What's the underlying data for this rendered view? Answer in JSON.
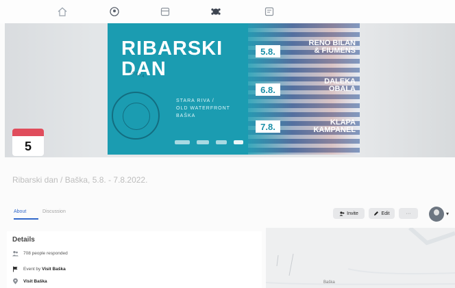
{
  "nav": {
    "icons": [
      "home-icon",
      "friends-icon",
      "store-icon",
      "groups-icon",
      "gaming-icon"
    ]
  },
  "banner": {
    "kicker": "",
    "title_line1": "RIBARSKI",
    "title_line2": "DAN",
    "venue_line1": "STARA RIVA /",
    "venue_line2": "OLD WATERFRONT",
    "venue_line3": "BAŠKA",
    "stamp_text": "BAŠKA",
    "lineup": [
      {
        "date": "5.8.",
        "performer_line1": "RENO BILAN",
        "performer_line2": "& FIUMENS"
      },
      {
        "date": "6.8.",
        "performer_line1": "DALEKA",
        "performer_line2": "OBALA"
      },
      {
        "date": "7.8.",
        "performer_line1": "KLAPA",
        "performer_line2": "KAMPANEL"
      }
    ]
  },
  "calendar": {
    "day": "5",
    "accent": "#e04d5c"
  },
  "event": {
    "title": "Ribarski dan / Baška, 5.8. - 7.8.2022."
  },
  "tabs": {
    "about": "About",
    "discussion": "Discussion"
  },
  "actions": {
    "invite": "Invite",
    "edit": "Edit",
    "more": "···"
  },
  "details": {
    "heading": "Details",
    "responded": "708 people responded",
    "event_by_prefix": "Event by",
    "event_by_name": "Visit Baška",
    "location": "Visit Baška"
  },
  "map": {
    "label": "Baška"
  },
  "colors": {
    "accent_blue": "#2f66c9",
    "banner_teal": "#1b9cb1"
  }
}
